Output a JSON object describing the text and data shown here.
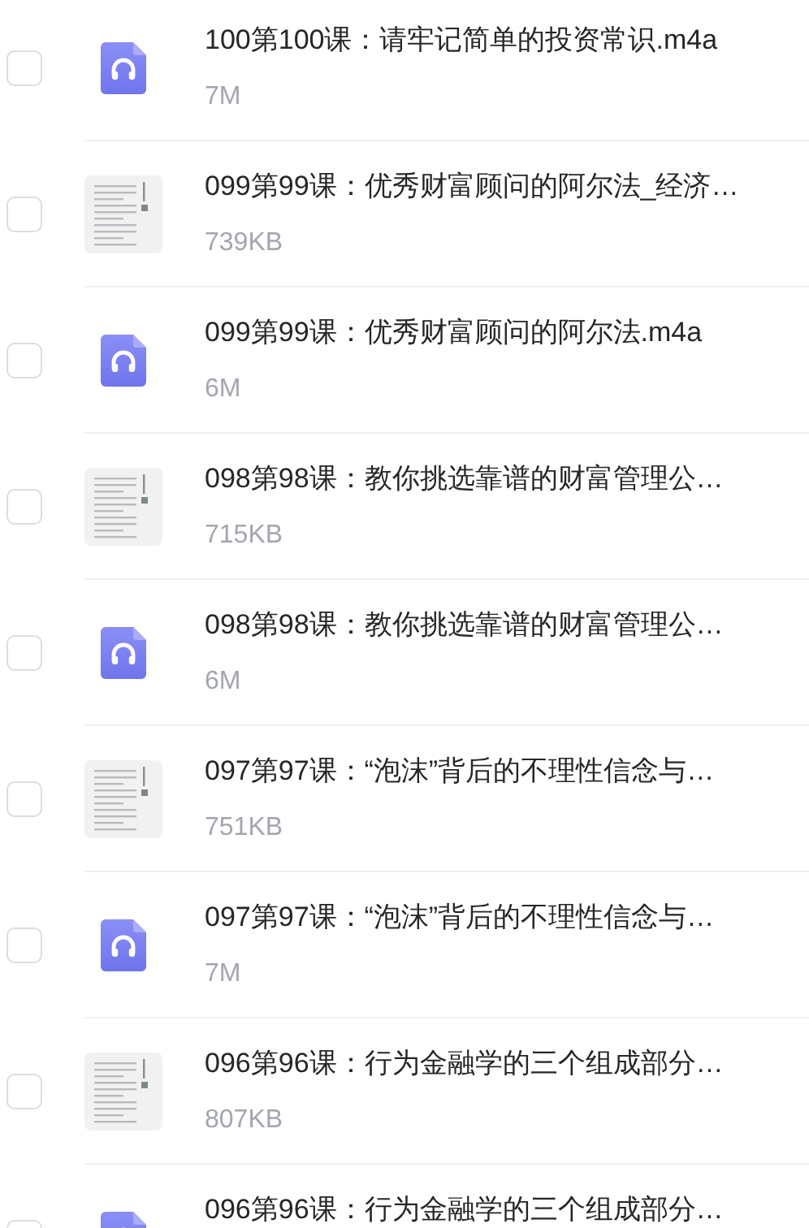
{
  "files": [
    {
      "kind": "audio",
      "title": "100第100课：请牢记简单的投资常识.m4a",
      "size": "7M",
      "checked": false
    },
    {
      "kind": "document",
      "title": "099第99课：优秀财富顾问的阿尔法_经济…",
      "size": "739KB",
      "checked": false
    },
    {
      "kind": "audio",
      "title": "099第99课：优秀财富顾问的阿尔法.m4a",
      "size": "6M",
      "checked": false
    },
    {
      "kind": "document",
      "title": "098第98课：教你挑选靠谱的财富管理公…",
      "size": "715KB",
      "checked": false
    },
    {
      "kind": "audio",
      "title": "098第98课：教你挑选靠谱的财富管理公…",
      "size": "6M",
      "checked": false
    },
    {
      "kind": "document",
      "title": "097第97课：“泡沫”背后的不理性信念与…",
      "size": "751KB",
      "checked": false
    },
    {
      "kind": "audio",
      "title": "097第97课：“泡沫”背后的不理性信念与…",
      "size": "7M",
      "checked": false
    },
    {
      "kind": "document",
      "title": "096第96课：行为金融学的三个组成部分…",
      "size": "807KB",
      "checked": false
    },
    {
      "kind": "audio",
      "title": "096第96课：行为金融学的三个组成部分…",
      "checked": false
    }
  ]
}
